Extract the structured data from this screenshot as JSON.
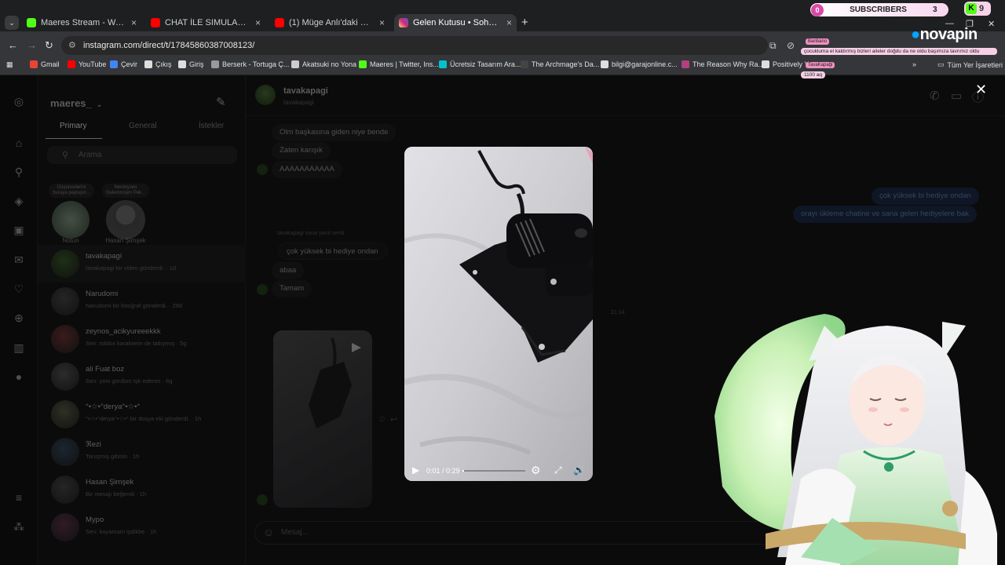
{
  "browser": {
    "tabs": [
      {
        "title": "Maeres Stream - Watch Live on",
        "favicon_color": "#53fc18",
        "active": false
      },
      {
        "title": "CHAT İLE SIMULASYON KEYFİ |",
        "favicon_color": "#ff0000",
        "active": false
      },
      {
        "title": "(1) Müge Anlı'daki Korkunç İspa",
        "favicon_color": "#ff0000",
        "active": false
      },
      {
        "title": "Gelen Kutusu • Sohbetler",
        "favicon_color": "#e1306c",
        "active": true
      }
    ],
    "new_tab": "+",
    "url": "instagram.com/direct/t/17845860387008123/",
    "bookmarks": [
      {
        "label": "Gmail",
        "color": "#ea4335"
      },
      {
        "label": "YouTube",
        "color": "#ff0000"
      },
      {
        "label": "Çevir",
        "color": "#4285f4"
      },
      {
        "label": "Çıkış",
        "color": "#dddddd"
      },
      {
        "label": "Giriş",
        "color": "#dddddd"
      },
      {
        "label": "Berserk - Tortuga Ç...",
        "color": "#999999"
      },
      {
        "label": "Akatsuki no Yona",
        "color": "#cccccc"
      },
      {
        "label": "Maeres | Twitter, Ins...",
        "color": "#53fc18"
      },
      {
        "label": "Ücretsiz Tasarım Ara...",
        "color": "#00c4cc"
      },
      {
        "label": "The Archmage's Da...",
        "color": "#444444"
      },
      {
        "label": "bilgi@garajonline.c...",
        "color": "#dddddd"
      },
      {
        "label": "The Reason Why Ra...",
        "color": "#b04080"
      },
      {
        "label": "Positively Yo...",
        "color": "#dddddd"
      }
    ],
    "bookmarks_more": "»",
    "all_bookmarks": "Tüm Yer İşaretleri"
  },
  "overlay": {
    "subscribers_label": "SUBSCRIBERS",
    "subscribers_left": "0",
    "subscribers_count": "3",
    "kick_count": "9",
    "brand_text": "novapin",
    "chat": [
      {
        "name": "Banbano",
        "text": "çocukluma el kaldırmış bizleri aileler doğdu da ne oldu başımıza tavrımız oldu"
      },
      {
        "name": "TavaKapaği",
        "text": "1100 aq"
      }
    ],
    "close_icon": "✕"
  },
  "instagram": {
    "username": "maeres_",
    "tabs": [
      "Primary",
      "General",
      "İstekler"
    ],
    "search_placeholder": "Arama",
    "notes": [
      {
        "bubble": "Düşüncelerini buraya paylaşın...",
        "name": "Notun"
      },
      {
        "bubble": "Nerdeysen Gelemmişim Pek...",
        "name": "Hasan Şimşek"
      }
    ],
    "conversations": [
      {
        "name": "tavakapagi",
        "sub": "tavakapagi bir video gönderdi. · 1d",
        "avatar": "#2d4a22",
        "selected": true
      },
      {
        "name": "Narudomi",
        "sub": "Narudomi bir fotoğraf gönderdi. · 29d",
        "avatar": "#3a3a3a",
        "selected": false
      },
      {
        "name": "zeynos_acikyureeekkk",
        "sub": "Sen: roblox karakterin de tatlıymış · 5g",
        "avatar": "#5a2a2a",
        "selected": false
      },
      {
        "name": "ali Fuat boz",
        "sub": "Sen: yeni gördüm tşk ederim · 6g",
        "avatar": "#444444",
        "selected": false
      },
      {
        "name": "°•☆•°derya°•☆•°",
        "sub": "°•☆•°derya°•☆•° bir dosya eki gönderdi. · 1h",
        "avatar": "#4a4a3a",
        "selected": false
      },
      {
        "name": "ℜezi",
        "sub": "Tanışmış gibisin · 1h",
        "avatar": "#2a3a4a",
        "selected": false
      },
      {
        "name": "Hasan Şimşek",
        "sub": "Bir mesajı beğendi · 1h",
        "avatar": "#3a3a3a",
        "selected": false
      },
      {
        "name": "Mypo",
        "sub": "Sen: koyamam işdikbe · 1h",
        "avatar": "#4a2a3a",
        "selected": false
      }
    ],
    "thread": {
      "name": "tavakapagi",
      "handle": "tavakapagi",
      "messages_in_top": [
        "Olm başkasına giden niye bende",
        "Zaten karışık",
        "AAAAAAAAAAA"
      ],
      "messages_out": [
        "çok yüksek bi hediye ondan",
        "orayı ükleme chatine ve sana gelen hediyelere bak"
      ],
      "replied_label": "tavakapagi sana yanıt verdi",
      "reply_quote": "çok yüksek bi hediye ondan",
      "messages_in_bottom": [
        "abaa",
        "Tamam"
      ],
      "timestamp": "21:14",
      "composer_placeholder": "Mesaj..."
    },
    "video": {
      "time": "0:01 / 0:29",
      "progress": 0.03
    }
  }
}
